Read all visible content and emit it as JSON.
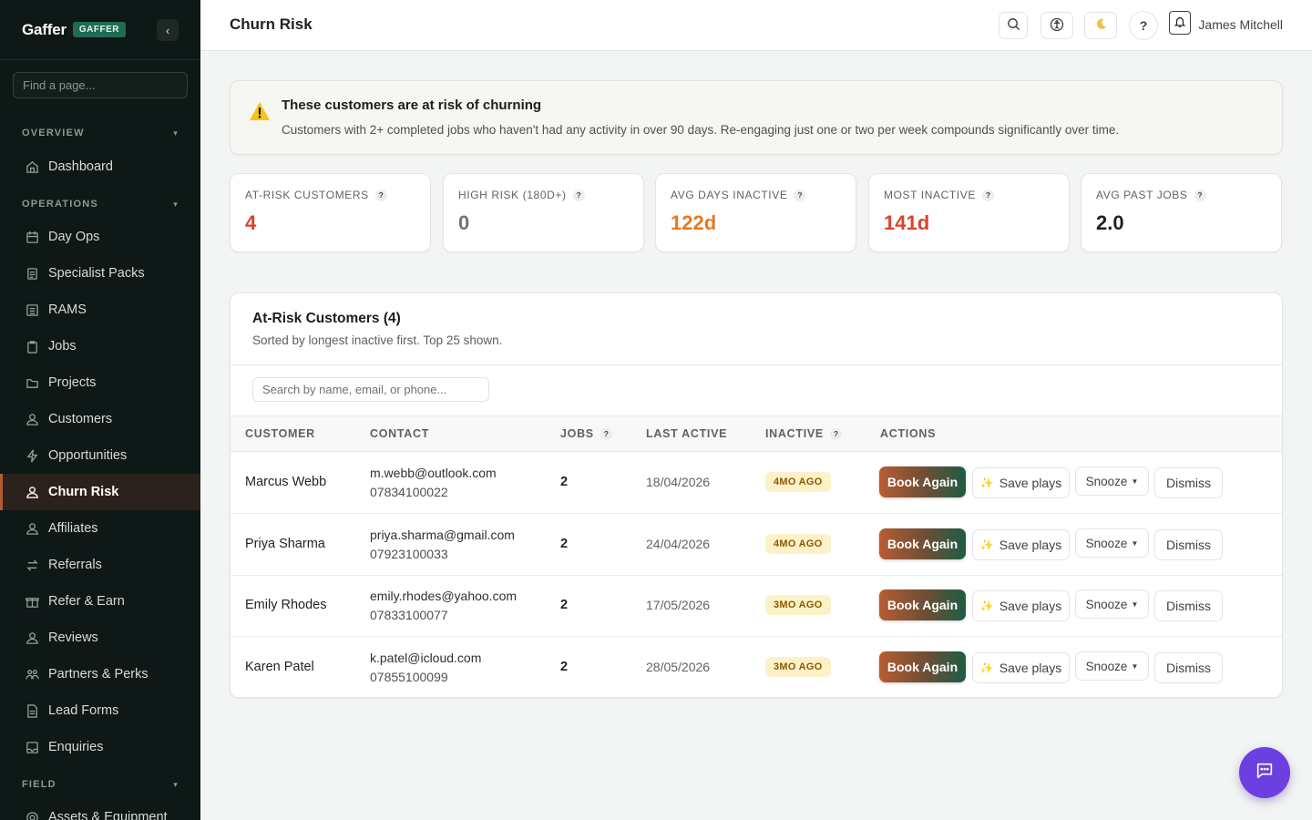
{
  "brand": {
    "name": "Gaffer",
    "badge": "GAFFER"
  },
  "sidebar": {
    "find_placeholder": "Find a page...",
    "sections": [
      {
        "title": "OVERVIEW",
        "items": [
          {
            "label": "Dashboard",
            "icon": "home-icon"
          }
        ]
      },
      {
        "title": "OPERATIONS",
        "items": [
          {
            "label": "Day Ops",
            "icon": "calendar-icon"
          },
          {
            "label": "Specialist Packs",
            "icon": "document-icon"
          },
          {
            "label": "RAMS",
            "icon": "list-icon"
          },
          {
            "label": "Jobs",
            "icon": "clipboard-icon"
          },
          {
            "label": "Projects",
            "icon": "folder-icon"
          },
          {
            "label": "Customers",
            "icon": "users-icon"
          },
          {
            "label": "Opportunities",
            "icon": "bolt-icon"
          },
          {
            "label": "Churn Risk",
            "icon": "user-alert-icon",
            "active": true
          },
          {
            "label": "Affiliates",
            "icon": "users-icon"
          },
          {
            "label": "Referrals",
            "icon": "swap-icon"
          },
          {
            "label": "Refer & Earn",
            "icon": "gift-icon"
          },
          {
            "label": "Reviews",
            "icon": "users-icon"
          },
          {
            "label": "Partners & Perks",
            "icon": "handshake-icon"
          },
          {
            "label": "Lead Forms",
            "icon": "form-icon"
          },
          {
            "label": "Enquiries",
            "icon": "inbox-icon"
          }
        ]
      },
      {
        "title": "FIELD",
        "items": [
          {
            "label": "Assets & Equipment",
            "icon": "gear-icon"
          }
        ]
      }
    ]
  },
  "header": {
    "title": "Churn Risk",
    "user_name": "James Mitchell",
    "help_label": "?"
  },
  "alert": {
    "title": "These customers are at risk of churning",
    "text": "Customers with 2+ completed jobs who haven't had any activity in over 90 days. Re-engaging just one or two per week compounds significantly over time."
  },
  "stats": [
    {
      "label": "AT-RISK CUSTOMERS",
      "value": "4",
      "color": "#d9432b"
    },
    {
      "label": "HIGH RISK (180D+)",
      "value": "0",
      "color": "#6d7471"
    },
    {
      "label": "AVG DAYS INACTIVE",
      "value": "122d",
      "color": "#e57a1f"
    },
    {
      "label": "MOST INACTIVE",
      "value": "141d",
      "color": "#d9432b"
    },
    {
      "label": "AVG PAST JOBS",
      "value": "2.0",
      "color": "#1d2320"
    }
  ],
  "table": {
    "title": "At-Risk Customers (4)",
    "subtitle": "Sorted by longest inactive first. Top 25 shown.",
    "search_placeholder": "Search by name, email, or phone...",
    "columns": [
      "CUSTOMER",
      "CONTACT",
      "JOBS",
      "LAST ACTIVE",
      "INACTIVE",
      "ACTIONS"
    ],
    "actions": {
      "book": "Book Again",
      "save": "Save plays",
      "snooze": "Snooze",
      "dismiss": "Dismiss"
    },
    "rows": [
      {
        "name": "Marcus Webb",
        "email": "m.webb@outlook.com",
        "phone": "07834100022",
        "jobs": "2",
        "last_active": "18/04/2026",
        "inactive": "4MO AGO"
      },
      {
        "name": "Priya Sharma",
        "email": "priya.sharma@gmail.com",
        "phone": "07923100033",
        "jobs": "2",
        "last_active": "24/04/2026",
        "inactive": "4MO AGO"
      },
      {
        "name": "Emily Rhodes",
        "email": "emily.rhodes@yahoo.com",
        "phone": "07833100077",
        "jobs": "2",
        "last_active": "17/05/2026",
        "inactive": "3MO AGO"
      },
      {
        "name": "Karen Patel",
        "email": "k.patel@icloud.com",
        "phone": "07855100099",
        "jobs": "2",
        "last_active": "28/05/2026",
        "inactive": "3MO AGO"
      }
    ]
  },
  "colors": {
    "accent": "#b35a30",
    "sidebar_bg": "#0e1816",
    "fab": "#6b3fe0"
  }
}
